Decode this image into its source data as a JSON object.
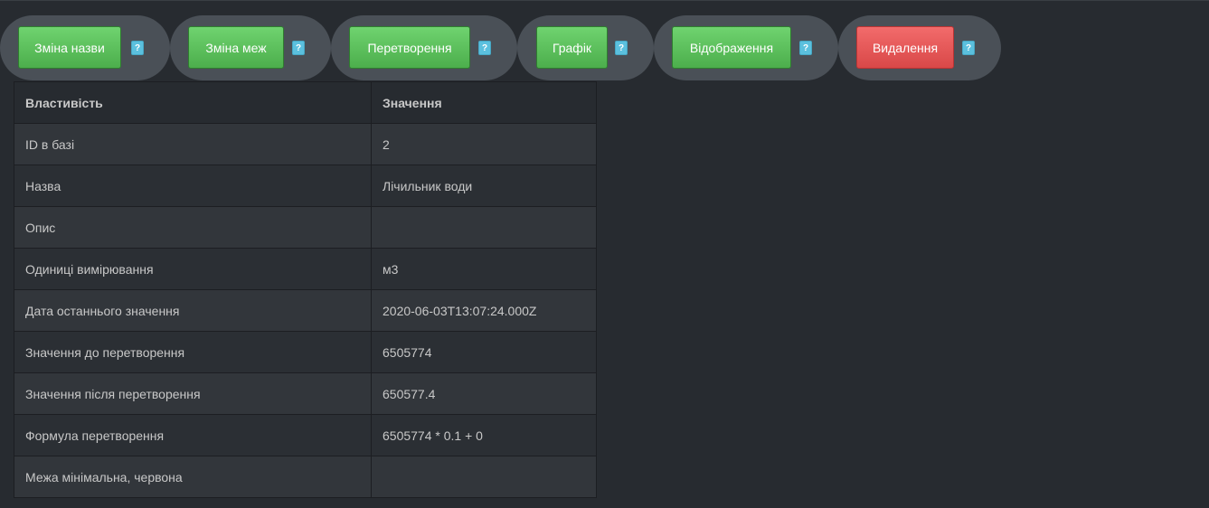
{
  "toolbar": {
    "rename_label": "Зміна назви",
    "limits_label": "Зміна меж",
    "transform_label": "Перетворення",
    "chart_label": "Графік",
    "display_label": "Відображення",
    "delete_label": "Видалення",
    "help_label": "?"
  },
  "colors": {
    "success": "#5cb85c",
    "danger": "#d9534f",
    "info": "#5bc0de",
    "background": "#272b30"
  },
  "table": {
    "headers": [
      "Властивість",
      "Значення"
    ],
    "rows": [
      [
        "ID в базі",
        "2"
      ],
      [
        "Назва",
        "Лічильник води"
      ],
      [
        "Опис",
        ""
      ],
      [
        "Одиниці вимірювання",
        "м3"
      ],
      [
        "Дата останнього значення",
        "2020-06-03T13:07:24.000Z"
      ],
      [
        "Значення до перетворення",
        "6505774"
      ],
      [
        "Значення після перетворення",
        "650577.4"
      ],
      [
        "Формула перетворення",
        "6505774 * 0.1 + 0"
      ],
      [
        "Межа мінімальна, червона",
        ""
      ]
    ]
  }
}
